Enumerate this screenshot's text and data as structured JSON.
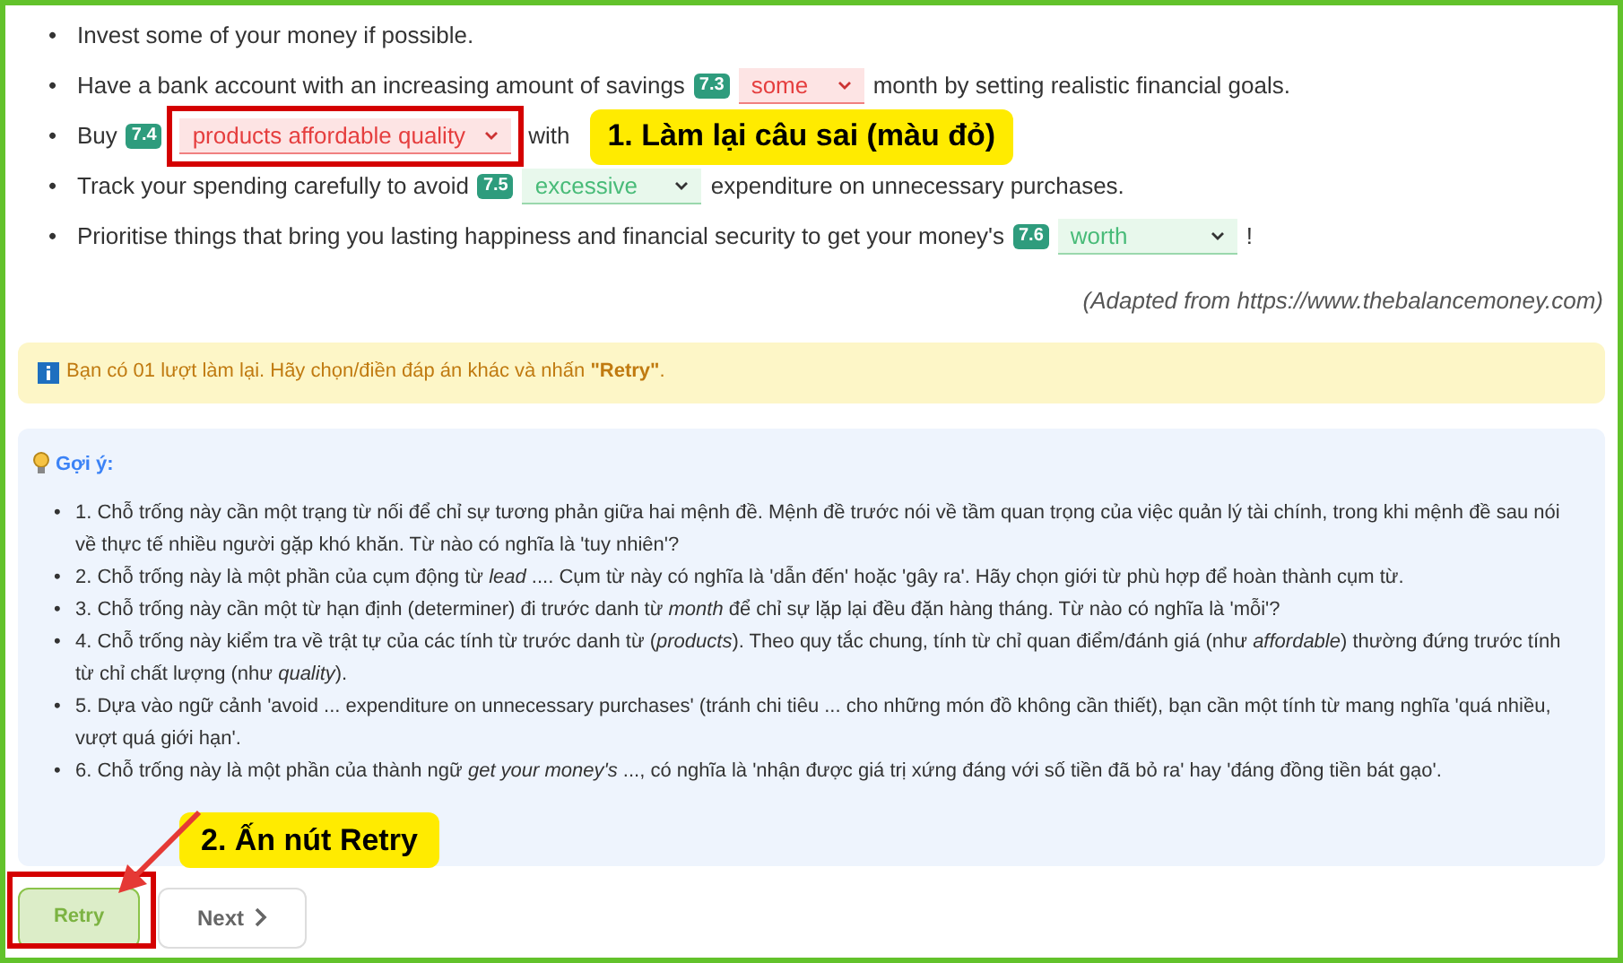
{
  "sentences": [
    {
      "bullet": "•",
      "parts": [
        {
          "kind": "text",
          "text": "Invest some of your money if possible."
        }
      ]
    },
    {
      "bullet": "•",
      "parts": [
        {
          "kind": "text",
          "text": "Have a bank account with an increasing amount of savings"
        },
        {
          "kind": "gap",
          "number": "7.3",
          "value": "some",
          "correct": false,
          "highlighted": false
        },
        {
          "kind": "text",
          "text": "month by setting realistic financial goals."
        }
      ]
    },
    {
      "bullet": "•",
      "parts": [
        {
          "kind": "text",
          "text": "Buy"
        },
        {
          "kind": "gap",
          "number": "7.4",
          "value": "products affordable quality",
          "correct": false,
          "highlighted": true
        },
        {
          "kind": "text",
          "text": "with"
        }
      ]
    },
    {
      "bullet": "•",
      "parts": [
        {
          "kind": "text",
          "text": "Track your spending carefully to avoid"
        },
        {
          "kind": "gap",
          "number": "7.5",
          "value": "excessive",
          "correct": true,
          "highlighted": false
        },
        {
          "kind": "text",
          "text": "expenditure on unnecessary purchases."
        }
      ]
    },
    {
      "bullet": "•",
      "parts": [
        {
          "kind": "text",
          "text": "Prioritise things that bring you lasting happiness and financial security to get your money's"
        },
        {
          "kind": "gap",
          "number": "7.6",
          "value": "worth",
          "correct": true,
          "highlighted": false
        },
        {
          "kind": "text",
          "text": "!"
        }
      ]
    }
  ],
  "source": "(Adapted from https://www.thebalancemoney.com)",
  "notice": "Bạn có 01 lượt làm lại. Hãy chọn/điền đáp án khác và nhấn **\"Retry\"**.",
  "hints": {
    "title": "Gợi ý:",
    "items": [
      {
        "bullet": "•",
        "text": "1. Chỗ trống này cần một trạng từ nối để chỉ sự tương phản giữa hai mệnh đề. Mệnh đề trước nói về tầm quan trọng của việc quản lý tài chính, trong khi mệnh đề sau nói về thực tế nhiều người gặp khó khăn. Từ nào có nghĩa là 'tuy nhiên'?"
      },
      {
        "bullet": "•",
        "text": "2. Chỗ trống này là một phần của cụm động từ *lead* .... Cụm từ này có nghĩa là 'dẫn đến' hoặc 'gây ra'. Hãy chọn giới từ phù hợp để hoàn thành cụm từ."
      },
      {
        "bullet": "•",
        "text": "3. Chỗ trống này cần một từ hạn định (determiner) đi trước danh từ *month* để chỉ sự lặp lại đều đặn hàng tháng. Từ nào có nghĩa là 'mỗi'?"
      },
      {
        "bullet": "•",
        "text": "4. Chỗ trống này kiểm tra về trật tự của các tính từ trước danh từ (*products*). Theo quy tắc chung, tính từ chỉ quan điểm/đánh giá (như *affordable*) thường đứng trước tính từ chỉ chất lượng (như *quality*)."
      },
      {
        "bullet": "•",
        "text": "5. Dựa vào ngữ cảnh 'avoid ... expenditure on unnecessary purchases' (tránh chi tiêu ... cho những món đồ không cần thiết), bạn cần một tính từ mang nghĩa 'quá nhiều, vượt quá giới hạn'."
      },
      {
        "bullet": "•",
        "text": "6. Chỗ trống này là một phần của thành ngữ *get your money's* ..., có nghĩa là 'nhận được giá trị xứng đáng với số tiền đã bỏ ra' hay 'đáng đồng tiền bát gạo'."
      }
    ]
  },
  "buttons": {
    "retry": "Retry",
    "next": "Next"
  },
  "annotations": {
    "step_1": "1. Làm lại câu sai (màu đỏ)",
    "step_2": "2. Ấn nút Retry"
  }
}
